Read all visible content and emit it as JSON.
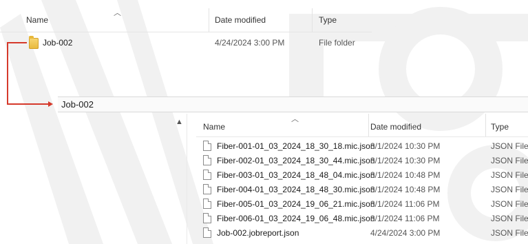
{
  "top_pane": {
    "columns": {
      "name": "Name",
      "date_modified": "Date modified",
      "type": "Type"
    },
    "rows": [
      {
        "name": "Job-002",
        "date_modified": "4/24/2024 3:00 PM",
        "type": "File folder",
        "icon": "folder-icon"
      }
    ]
  },
  "address_bar": {
    "path": "Job-002"
  },
  "bottom_pane": {
    "columns": {
      "name": "Name",
      "date_modified": "Date modified",
      "type": "Type"
    },
    "rows": [
      {
        "name": "Fiber-001-01_03_2024_18_30_18.mic.json",
        "date_modified": "3/1/2024 10:30 PM",
        "type": "JSON File",
        "icon": "document-icon"
      },
      {
        "name": "Fiber-002-01_03_2024_18_30_44.mic.json",
        "date_modified": "3/1/2024 10:30 PM",
        "type": "JSON File",
        "icon": "document-icon"
      },
      {
        "name": "Fiber-003-01_03_2024_18_48_04.mic.json",
        "date_modified": "3/1/2024 10:48 PM",
        "type": "JSON File",
        "icon": "document-icon"
      },
      {
        "name": "Fiber-004-01_03_2024_18_48_30.mic.json",
        "date_modified": "3/1/2024 10:48 PM",
        "type": "JSON File",
        "icon": "document-icon"
      },
      {
        "name": "Fiber-005-01_03_2024_19_06_21.mic.json",
        "date_modified": "3/1/2024 11:06 PM",
        "type": "JSON File",
        "icon": "document-icon"
      },
      {
        "name": "Fiber-006-01_03_2024_19_06_48.mic.json",
        "date_modified": "3/1/2024 11:06 PM",
        "type": "JSON File",
        "icon": "document-icon"
      },
      {
        "name": "Job-002.jobreport.json",
        "date_modified": "4/24/2024 3:00 PM",
        "type": "JSON File",
        "icon": "document-icon"
      }
    ]
  },
  "colors": {
    "connector": "#d5392b",
    "folder": "#e8b83a",
    "watermark": "#f1f1f1"
  }
}
